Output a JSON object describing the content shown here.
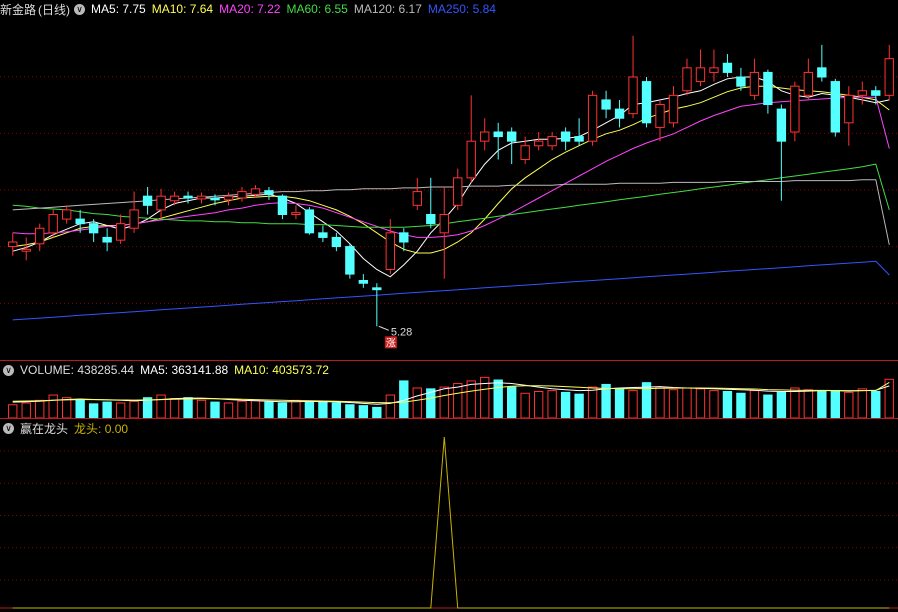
{
  "stock": {
    "name": "新金路",
    "period": "(日线)"
  },
  "ma_legend": [
    {
      "label": "MA5: ",
      "value": "7.75",
      "color": "#ffffff"
    },
    {
      "label": "MA10: ",
      "value": "7.64",
      "color": "#ffff55"
    },
    {
      "label": "MA20: ",
      "value": "7.22",
      "color": "#ff44ff"
    },
    {
      "label": "MA60: ",
      "value": "6.55",
      "color": "#44dd44"
    },
    {
      "label": "MA120: ",
      "value": "6.17",
      "color": "#bbbbbb"
    },
    {
      "label": "MA250: ",
      "value": "5.84",
      "color": "#3355ff"
    }
  ],
  "low_marker": {
    "price": "5.28",
    "badge": "涨"
  },
  "volume": {
    "label": "VOLUME: ",
    "value": "438285.44",
    "ma5_label": "MA5: ",
    "ma5": "363141.88",
    "ma10_label": "MA10: ",
    "ma10": "403573.72"
  },
  "indicator": {
    "name": "赢在龙头",
    "line_label": "龙头: ",
    "value": "0.00"
  },
  "colors": {
    "up": "#ff3232",
    "down": "#54ffff",
    "grid": "#8b0000",
    "separator": "#b81c1c"
  },
  "chart_data": [
    {
      "type": "candlestick",
      "title": "新金路 (日线)",
      "ylim": [
        5.0,
        8.6
      ],
      "candles": [
        [
          6.15,
          6.2,
          6.3,
          6.05
        ],
        [
          6.1,
          6.12,
          6.25,
          6.0
        ],
        [
          6.18,
          6.35,
          6.4,
          6.1
        ],
        [
          6.3,
          6.5,
          6.55,
          6.25
        ],
        [
          6.45,
          6.55,
          6.6,
          6.4
        ],
        [
          6.45,
          6.4,
          6.55,
          6.3
        ],
        [
          6.4,
          6.3,
          6.45,
          6.2
        ],
        [
          6.25,
          6.2,
          6.35,
          6.1
        ],
        [
          6.22,
          6.4,
          6.5,
          6.18
        ],
        [
          6.35,
          6.55,
          6.75,
          6.3
        ],
        [
          6.7,
          6.6,
          6.8,
          6.5
        ],
        [
          6.55,
          6.7,
          6.78,
          6.45
        ],
        [
          6.65,
          6.7,
          6.75,
          6.6
        ],
        [
          6.7,
          6.68,
          6.75,
          6.62
        ],
        [
          6.67,
          6.7,
          6.74,
          6.62
        ],
        [
          6.68,
          6.66,
          6.72,
          6.6
        ],
        [
          6.66,
          6.7,
          6.74,
          6.6
        ],
        [
          6.68,
          6.75,
          6.8,
          6.64
        ],
        [
          6.72,
          6.78,
          6.82,
          6.68
        ],
        [
          6.76,
          6.72,
          6.8,
          6.66
        ],
        [
          6.7,
          6.5,
          6.72,
          6.45
        ],
        [
          6.5,
          6.52,
          6.6,
          6.45
        ],
        [
          6.55,
          6.3,
          6.58,
          6.28
        ],
        [
          6.3,
          6.25,
          6.38,
          6.2
        ],
        [
          6.25,
          6.15,
          6.3,
          6.1
        ],
        [
          6.15,
          5.85,
          6.18,
          5.8
        ],
        [
          5.78,
          5.75,
          5.85,
          5.7
        ],
        [
          5.7,
          5.68,
          5.75,
          5.28
        ],
        [
          5.9,
          6.3,
          6.45,
          5.85
        ],
        [
          6.3,
          6.2,
          6.35,
          6.1
        ],
        [
          6.6,
          6.75,
          6.9,
          6.55
        ],
        [
          6.5,
          6.4,
          6.9,
          6.35
        ],
        [
          6.3,
          6.5,
          6.8,
          5.8
        ],
        [
          6.6,
          6.9,
          7.0,
          6.55
        ],
        [
          6.9,
          7.3,
          7.8,
          6.85
        ],
        [
          7.3,
          7.4,
          7.55,
          7.2
        ],
        [
          7.4,
          7.35,
          7.5,
          7.1
        ],
        [
          7.4,
          7.3,
          7.45,
          7.05
        ],
        [
          7.1,
          7.25,
          7.35,
          7.05
        ],
        [
          7.25,
          7.3,
          7.4,
          7.2
        ],
        [
          7.25,
          7.35,
          7.4,
          7.2
        ],
        [
          7.4,
          7.3,
          7.45,
          7.2
        ],
        [
          7.35,
          7.3,
          7.55,
          7.25
        ],
        [
          7.3,
          7.8,
          7.85,
          7.25
        ],
        [
          7.75,
          7.65,
          7.85,
          7.55
        ],
        [
          7.65,
          7.55,
          7.75,
          7.45
        ],
        [
          7.6,
          8.0,
          8.45,
          7.55
        ],
        [
          7.95,
          7.5,
          8.0,
          7.45
        ],
        [
          7.45,
          7.7,
          7.75,
          7.3
        ],
        [
          7.5,
          7.8,
          7.9,
          7.45
        ],
        [
          7.85,
          8.1,
          8.2,
          7.8
        ],
        [
          7.95,
          8.1,
          8.3,
          7.9
        ],
        [
          8.05,
          8.1,
          8.3,
          7.95
        ],
        [
          8.15,
          8.05,
          8.25,
          8.0
        ],
        [
          8.0,
          7.9,
          8.1,
          7.85
        ],
        [
          7.8,
          8.05,
          8.2,
          7.75
        ],
        [
          8.05,
          7.7,
          8.08,
          7.6
        ],
        [
          7.65,
          7.3,
          7.7,
          6.65
        ],
        [
          7.4,
          7.9,
          7.95,
          7.3
        ],
        [
          7.8,
          8.05,
          8.2,
          7.75
        ],
        [
          8.1,
          8.0,
          8.35,
          7.95
        ],
        [
          7.95,
          7.4,
          7.98,
          7.35
        ],
        [
          7.5,
          7.8,
          7.9,
          7.25
        ],
        [
          7.8,
          7.85,
          7.95,
          7.7
        ],
        [
          7.85,
          7.8,
          7.9,
          7.7
        ],
        [
          7.8,
          8.2,
          8.35,
          7.75
        ]
      ],
      "series": [
        {
          "name": "MA5",
          "values": [
            6.1,
            6.14,
            6.2,
            6.28,
            6.34,
            6.4,
            6.42,
            6.38,
            6.34,
            6.38,
            6.45,
            6.55,
            6.62,
            6.65,
            6.68,
            6.68,
            6.69,
            6.7,
            6.71,
            6.72,
            6.68,
            6.62,
            6.52,
            6.42,
            6.32,
            6.18,
            6.02,
            5.9,
            5.82,
            5.95,
            6.1,
            6.3,
            6.45,
            6.62,
            6.85,
            7.05,
            7.2,
            7.28,
            7.3,
            7.32,
            7.32,
            7.33,
            7.35,
            7.42,
            7.5,
            7.58,
            7.7,
            7.72,
            7.75,
            7.78,
            7.82,
            7.85,
            7.92,
            7.98,
            8.0,
            8.0,
            7.95,
            7.85,
            7.8,
            7.78,
            7.82,
            7.8,
            7.78,
            7.75,
            7.72,
            7.75
          ]
        },
        {
          "name": "MA10",
          "values": [
            6.15,
            6.17,
            6.2,
            6.25,
            6.3,
            6.35,
            6.37,
            6.38,
            6.38,
            6.4,
            6.42,
            6.46,
            6.5,
            6.54,
            6.58,
            6.62,
            6.65,
            6.68,
            6.69,
            6.7,
            6.7,
            6.68,
            6.65,
            6.6,
            6.55,
            6.48,
            6.4,
            6.3,
            6.2,
            6.12,
            6.08,
            6.08,
            6.12,
            6.2,
            6.3,
            6.45,
            6.62,
            6.78,
            6.9,
            7.0,
            7.1,
            7.18,
            7.25,
            7.32,
            7.38,
            7.42,
            7.48,
            7.55,
            7.6,
            7.65,
            7.68,
            7.72,
            7.78,
            7.84,
            7.88,
            7.9,
            7.9,
            7.88,
            7.86,
            7.85,
            7.84,
            7.82,
            7.8,
            7.78,
            7.75,
            7.64
          ]
        },
        {
          "name": "MA20",
          "values": [
            6.3,
            6.29,
            6.29,
            6.3,
            6.31,
            6.33,
            6.35,
            6.37,
            6.38,
            6.4,
            6.42,
            6.44,
            6.46,
            6.48,
            6.5,
            6.52,
            6.55,
            6.57,
            6.6,
            6.62,
            6.63,
            6.62,
            6.6,
            6.57,
            6.52,
            6.47,
            6.42,
            6.37,
            6.32,
            6.28,
            6.25,
            6.25,
            6.26,
            6.28,
            6.32,
            6.38,
            6.45,
            6.52,
            6.6,
            6.68,
            6.76,
            6.84,
            6.92,
            7.0,
            7.08,
            7.15,
            7.22,
            7.28,
            7.33,
            7.38,
            7.45,
            7.52,
            7.58,
            7.63,
            7.68,
            7.7,
            7.72,
            7.73,
            7.74,
            7.75,
            7.76,
            7.77,
            7.78,
            7.78,
            7.78,
            7.22
          ]
        },
        {
          "name": "MA60",
          "values": [
            6.6,
            6.59,
            6.57,
            6.56,
            6.55,
            6.53,
            6.51,
            6.5,
            6.48,
            6.47,
            6.46,
            6.45,
            6.44,
            6.43,
            6.43,
            6.42,
            6.42,
            6.41,
            6.41,
            6.4,
            6.4,
            6.4,
            6.39,
            6.39,
            6.38,
            6.37,
            6.36,
            6.36,
            6.36,
            6.36,
            6.37,
            6.38,
            6.4,
            6.42,
            6.44,
            6.46,
            6.48,
            6.5,
            6.52,
            6.54,
            6.56,
            6.58,
            6.6,
            6.62,
            6.64,
            6.66,
            6.68,
            6.7,
            6.72,
            6.74,
            6.76,
            6.78,
            6.8,
            6.82,
            6.84,
            6.86,
            6.88,
            6.9,
            6.92,
            6.94,
            6.96,
            6.98,
            7.0,
            7.02,
            7.05,
            6.55
          ]
        },
        {
          "name": "MA120",
          "values": [
            6.55,
            6.56,
            6.57,
            6.58,
            6.59,
            6.6,
            6.61,
            6.62,
            6.63,
            6.64,
            6.65,
            6.66,
            6.67,
            6.68,
            6.69,
            6.7,
            6.71,
            6.72,
            6.73,
            6.74,
            6.75,
            6.75,
            6.76,
            6.76,
            6.77,
            6.77,
            6.78,
            6.78,
            6.78,
            6.79,
            6.79,
            6.8,
            6.8,
            6.8,
            6.81,
            6.81,
            6.81,
            6.82,
            6.82,
            6.82,
            6.82,
            6.83,
            6.83,
            6.83,
            6.83,
            6.84,
            6.84,
            6.84,
            6.84,
            6.85,
            6.85,
            6.85,
            6.85,
            6.86,
            6.86,
            6.86,
            6.86,
            6.86,
            6.87,
            6.87,
            6.87,
            6.87,
            6.87,
            6.88,
            6.88,
            6.17
          ]
        },
        {
          "name": "MA250",
          "values": [
            5.35,
            5.36,
            5.37,
            5.38,
            5.39,
            5.4,
            5.41,
            5.42,
            5.43,
            5.44,
            5.45,
            5.46,
            5.47,
            5.48,
            5.49,
            5.5,
            5.51,
            5.52,
            5.53,
            5.54,
            5.55,
            5.56,
            5.57,
            5.58,
            5.59,
            5.6,
            5.61,
            5.62,
            5.63,
            5.64,
            5.65,
            5.66,
            5.67,
            5.68,
            5.69,
            5.7,
            5.71,
            5.72,
            5.73,
            5.74,
            5.75,
            5.76,
            5.77,
            5.78,
            5.79,
            5.8,
            5.81,
            5.82,
            5.83,
            5.84,
            5.85,
            5.86,
            5.87,
            5.88,
            5.89,
            5.9,
            5.91,
            5.92,
            5.93,
            5.94,
            5.95,
            5.96,
            5.97,
            5.98,
            5.99,
            5.84
          ]
        }
      ]
    },
    {
      "type": "bar",
      "title": "VOLUME",
      "ylim": [
        0,
        600000
      ],
      "values": [
        150000,
        170000,
        200000,
        260000,
        230000,
        210000,
        160000,
        180000,
        170000,
        190000,
        230000,
        260000,
        220000,
        230000,
        200000,
        180000,
        170000,
        190000,
        200000,
        180000,
        170000,
        200000,
        190000,
        180000,
        170000,
        150000,
        140000,
        120000,
        260000,
        420000,
        340000,
        330000,
        350000,
        390000,
        420000,
        460000,
        430000,
        350000,
        280000,
        300000,
        310000,
        290000,
        270000,
        350000,
        380000,
        330000,
        310000,
        400000,
        350000,
        320000,
        340000,
        330000,
        310000,
        300000,
        280000,
        310000,
        260000,
        290000,
        340000,
        320000,
        300000,
        310000,
        290000,
        330000,
        300000,
        438285
      ],
      "series": [
        {
          "name": "MA5",
          "values": [
            180000,
            185000,
            190000,
            200000,
            210000,
            215000,
            210000,
            205000,
            200000,
            195000,
            200000,
            210000,
            220000,
            225000,
            225000,
            220000,
            210000,
            200000,
            195000,
            190000,
            185000,
            185000,
            188000,
            186000,
            182000,
            175000,
            165000,
            155000,
            165000,
            200000,
            250000,
            290000,
            330000,
            350000,
            380000,
            390000,
            400000,
            390000,
            370000,
            350000,
            330000,
            320000,
            310000,
            315000,
            330000,
            340000,
            345000,
            350000,
            355000,
            345000,
            340000,
            335000,
            330000,
            325000,
            320000,
            315000,
            305000,
            300000,
            300000,
            305000,
            310000,
            310000,
            305000,
            310000,
            315000,
            363141
          ]
        },
        {
          "name": "MA10",
          "values": [
            190000,
            192000,
            195000,
            200000,
            205000,
            208000,
            208000,
            206000,
            204000,
            203000,
            205000,
            208000,
            212000,
            215000,
            217000,
            218000,
            216000,
            212000,
            208000,
            204000,
            200000,
            197000,
            195000,
            193000,
            190000,
            186000,
            180000,
            174000,
            172000,
            180000,
            200000,
            225000,
            255000,
            280000,
            305000,
            325000,
            345000,
            360000,
            365000,
            365000,
            362000,
            355000,
            348000,
            340000,
            335000,
            333000,
            332000,
            333000,
            336000,
            338000,
            340000,
            340000,
            338000,
            335000,
            332000,
            328000,
            322000,
            318000,
            315000,
            313000,
            312000,
            311000,
            310000,
            310000,
            311000,
            403573
          ]
        }
      ]
    },
    {
      "type": "line",
      "title": "赢在龙头",
      "ylim": [
        0,
        1
      ],
      "series": [
        {
          "name": "龙头",
          "values": [
            0,
            0,
            0,
            0,
            0,
            0,
            0,
            0,
            0,
            0,
            0,
            0,
            0,
            0,
            0,
            0,
            0,
            0,
            0,
            0,
            0,
            0,
            0,
            0,
            0,
            0,
            0,
            0,
            0,
            0,
            0,
            0,
            1,
            0,
            0,
            0,
            0,
            0,
            0,
            0,
            0,
            0,
            0,
            0,
            0,
            0,
            0,
            0,
            0,
            0,
            0,
            0,
            0,
            0,
            0,
            0,
            0,
            0,
            0,
            0,
            0,
            0,
            0,
            0,
            0,
            0
          ]
        }
      ]
    }
  ]
}
